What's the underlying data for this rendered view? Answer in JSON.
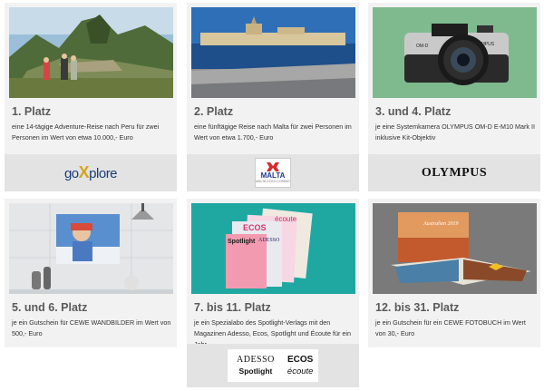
{
  "prizes": [
    {
      "title": "1. Platz",
      "text": "eine 14-tägige Adventure-Reise nach Peru für zwei Personen im Wert von etwa 10.000,- Euro",
      "image": "machu-picchu-photo",
      "logo": {
        "left": "go",
        "x": "X",
        "right": "plore"
      }
    },
    {
      "title": "2. Platz",
      "text": "eine fünftägige Reise nach Malta für zwei Personen im Wert von etwa 1.700,- Euro",
      "image": "valletta-harbour-photo",
      "logo": {
        "name": "MALTA",
        "tagline": "MALTA GOZO COMINO"
      }
    },
    {
      "title": "3. und 4. Platz",
      "text": "je eine Systemkamera OLYMPUS OM-D E-M10 Mark II inklusive Kit-Objektiv",
      "image": "olympus-camera-photo",
      "camera_label": "OM-D",
      "camera_brand": "OLYMPUS",
      "logo": {
        "name": "OLYMPUS"
      }
    },
    {
      "title": "5. und 6. Platz",
      "text": "je ein Gutschein für CEWE WANDBILDER im Wert von 500,- Euro",
      "image": "wall-picture-photo"
    },
    {
      "title": "7. bis 11. Platz",
      "text": "je ein Spezialabo des Spotlight-Verlags mit den Magazinen Adesso, Ecos, Spotlight und Écoute für ein Jahr",
      "image": "magazines-photo",
      "magazines": [
        "ECOS",
        "écoute",
        "ADESSO",
        "Spotlight"
      ],
      "logo": {
        "adesso": "ADESSO",
        "ecos": "ECOS",
        "spotlight": "Spotlight",
        "ecoute": "écoute"
      }
    },
    {
      "title": "12. bis 31. Platz",
      "text": "je ein Gutschein für ein CEWE FOTOBUCH im Wert von 30,- Euro",
      "image": "photobook-photo",
      "book_title": "Australien 2019"
    }
  ]
}
